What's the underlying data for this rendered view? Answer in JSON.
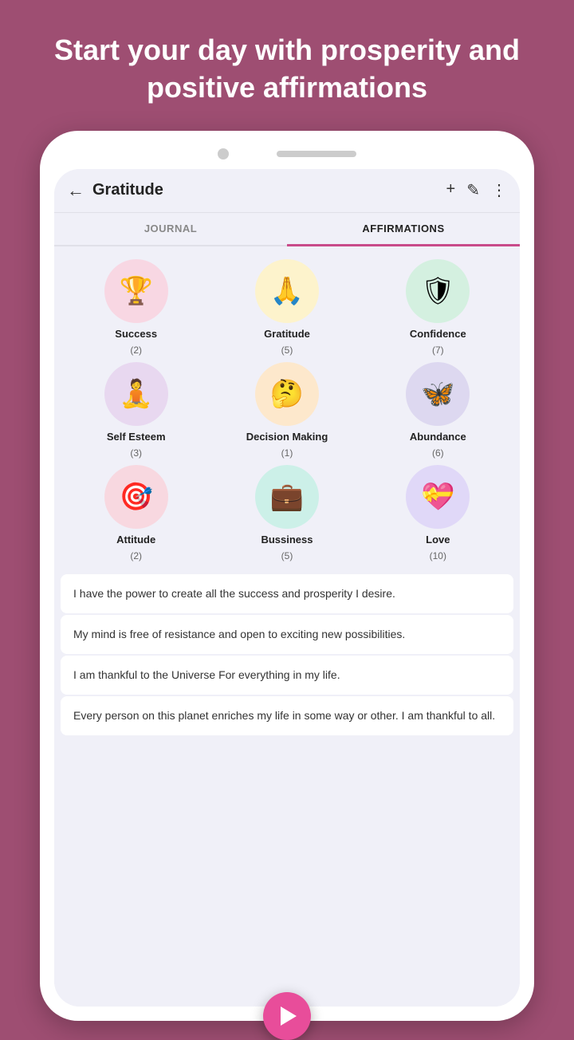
{
  "header": {
    "title": "Start your day with prosperity and positive affirmations"
  },
  "appBar": {
    "title": "Gratitude",
    "backLabel": "←",
    "icons": [
      "+",
      "✏",
      "⋮"
    ]
  },
  "tabs": [
    {
      "label": "JOURNAL",
      "active": false
    },
    {
      "label": "AFFIRMATIONS",
      "active": true
    }
  ],
  "categories": [
    {
      "name": "Success",
      "count": "(2)",
      "bg": "bg-pink",
      "icon": "🏆"
    },
    {
      "name": "Gratitude",
      "count": "(5)",
      "bg": "bg-yellow",
      "icon": "🙏"
    },
    {
      "name": "Confidence",
      "count": "(7)",
      "bg": "bg-green",
      "icon": "🛡"
    },
    {
      "name": "Self Esteem",
      "count": "(3)",
      "bg": "bg-purple",
      "icon": "🧘"
    },
    {
      "name": "Decision Making",
      "count": "(1)",
      "bg": "bg-orange",
      "icon": "🤔"
    },
    {
      "name": "Abundance",
      "count": "(6)",
      "bg": "bg-lavender",
      "icon": "🦋"
    },
    {
      "name": "Attitude",
      "count": "(2)",
      "bg": "bg-rose",
      "icon": "🎯"
    },
    {
      "name": "Bussiness",
      "count": "(5)",
      "bg": "bg-mint",
      "icon": "💼"
    },
    {
      "name": "Love",
      "count": "(10)",
      "bg": "bg-violet",
      "icon": "💝"
    }
  ],
  "affirmations": [
    {
      "text": "I have the power to create all the success and prosperity I desire."
    },
    {
      "text": "My mind is free of resistance and open to exciting new possibilities."
    },
    {
      "text": "I am thankful to the Universe For everything in my life."
    },
    {
      "text": "Every person on this planet enriches my life in some way or other. I am thankful to all."
    }
  ]
}
